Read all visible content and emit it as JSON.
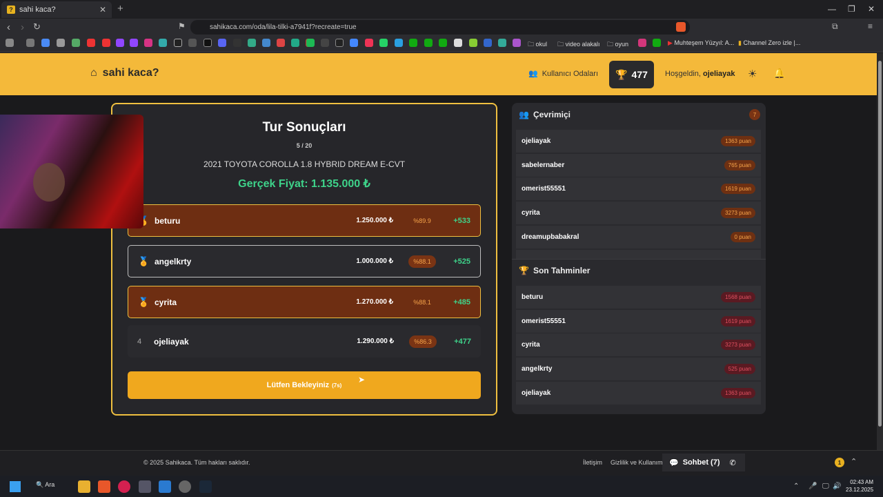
{
  "browser": {
    "tab_title": "sahi kaca?",
    "tab_favicon": "?",
    "close_glyph": "✕",
    "new_tab_glyph": "+",
    "url": "sahikaca.com/oda/lila-tilki-a7941f?recreate=true",
    "bookmarks": [
      "okul",
      "video alakalı",
      "oyun",
      "Muhteşem Yüzyıl: A...",
      "Channel Zero izle |..."
    ]
  },
  "header": {
    "logo_text": "sahi kaca?",
    "user_rooms_label": "Kullanıcı Odaları",
    "score": "477",
    "welcome_prefix": "Hoşgeldin,",
    "username": "ojeliayak"
  },
  "results": {
    "title": "Tur Sonuçları",
    "round": "5 / 20",
    "car": "2021 TOYOTA COROLLA 1.8 HYBRID DREAM E-CVT",
    "real_price": "Gerçek Fiyat: 1.135.000 ₺",
    "rows": [
      {
        "rank": "🏅",
        "name": "beturu",
        "guess": "1.250.000 ₺",
        "accuracy": "%89.9",
        "points": "+533",
        "style": "gold"
      },
      {
        "rank": "🏅",
        "name": "angelkrty",
        "guess": "1.000.000 ₺",
        "accuracy": "%88.1",
        "points": "+525",
        "style": "silver"
      },
      {
        "rank": "🏅",
        "name": "cyrita",
        "guess": "1.270.000 ₺",
        "accuracy": "%88.1",
        "points": "+485",
        "style": "gold"
      },
      {
        "rank": "4",
        "name": "ojeliayak",
        "guess": "1.290.000 ₺",
        "accuracy": "%86.3",
        "points": "+477",
        "style": "plain"
      }
    ],
    "wait_label": "Lütfen Bekleyiniz",
    "wait_timer": "(7s)"
  },
  "online": {
    "title": "Çevrimiçi",
    "count": "7",
    "users": [
      {
        "name": "ojeliayak",
        "points": "1363 puan"
      },
      {
        "name": "sabelernaber",
        "points": "765 puan"
      },
      {
        "name": "omerist55551",
        "points": "1619 puan"
      },
      {
        "name": "cyrita",
        "points": "3273 puan"
      },
      {
        "name": "dreamupbabakral",
        "points": "0 puan"
      }
    ]
  },
  "recent": {
    "title": "Son Tahminler",
    "users": [
      {
        "name": "beturu",
        "points": "1568 puan"
      },
      {
        "name": "omerist55551",
        "points": "1619 puan"
      },
      {
        "name": "cyrita",
        "points": "3273 puan"
      },
      {
        "name": "angelkrty",
        "points": "525 puan"
      },
      {
        "name": "ojeliayak",
        "points": "1363 puan"
      }
    ]
  },
  "footer": {
    "copyright": "© 2025 Sahikaca. Tüm hakları saklıdır.",
    "contact": "İletişim",
    "privacy": "Gizlilik ve Kullanım",
    "chat_label": "Sohbet (7)",
    "chat_badge": "1"
  },
  "taskbar": {
    "search_label": "Ara",
    "time": "02:43 AM",
    "date": "23.12.2025"
  },
  "colors": {
    "accent": "#f4b93a",
    "success": "#3ed38a",
    "gold_row": "#6e2e12"
  }
}
